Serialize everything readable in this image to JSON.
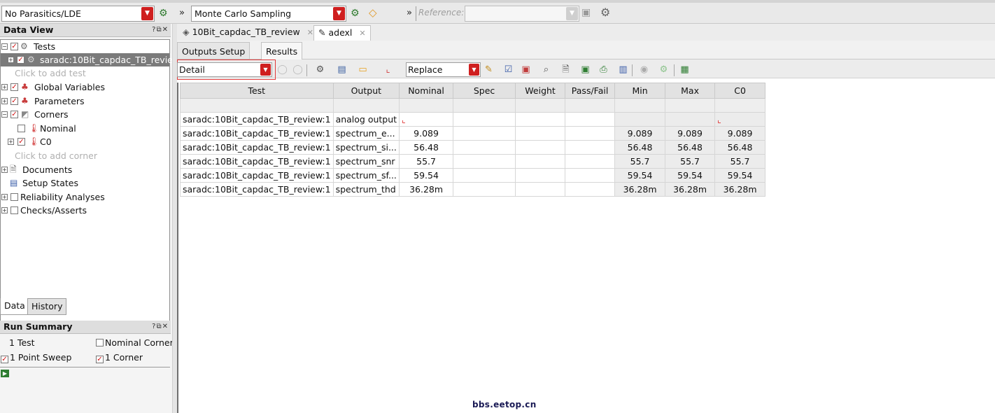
{
  "toolbar": {
    "parasitics_mode": "No Parasitics/LDE",
    "run_mode": "Monte Carlo Sampling",
    "reference_label": "Reference:",
    "reference_value": ""
  },
  "data_view": {
    "title": "Data View",
    "tree": [
      {
        "label": "Tests"
      },
      {
        "label": "saradc:10Bit_capdac_TB_revie.."
      },
      {
        "label": "Click to add test"
      },
      {
        "label": "Global Variables"
      },
      {
        "label": "Parameters"
      },
      {
        "label": "Corners"
      },
      {
        "label": "Nominal"
      },
      {
        "label": "C0"
      },
      {
        "label": "Click to add corner"
      },
      {
        "label": "Documents"
      },
      {
        "label": "Setup States"
      },
      {
        "label": "Reliability Analyses"
      },
      {
        "label": "Checks/Asserts"
      }
    ],
    "tabs": [
      "Data",
      "History"
    ]
  },
  "run_summary": {
    "title": "Run Summary",
    "tests": "1 Test",
    "nominal_corner": "Nominal Corner",
    "point_sweep": "1 Point Sweep",
    "corners": "1 Corner"
  },
  "doc_tabs": [
    {
      "label": "10Bit_capdac_TB_review"
    },
    {
      "label": "adexl"
    }
  ],
  "sub_tabs": [
    "Outputs Setup",
    "Results"
  ],
  "results_toolbar": {
    "view_mode": "Detail",
    "plot_mode": "Replace"
  },
  "results_table": {
    "columns": [
      "Test",
      "Output",
      "Nominal",
      "Spec",
      "Weight",
      "Pass/Fail",
      "Min",
      "Max",
      "C0"
    ],
    "rows": [
      {
        "test": "saradc:10Bit_capdac_TB_review:1",
        "output": "analog output",
        "nominal": "",
        "spec": "",
        "weight": "",
        "pass": "",
        "min": "",
        "max": "",
        "c0": ""
      },
      {
        "test": "saradc:10Bit_capdac_TB_review:1",
        "output": "spectrum_e...",
        "nominal": "9.089",
        "spec": "",
        "weight": "",
        "pass": "",
        "min": "9.089",
        "max": "9.089",
        "c0": "9.089"
      },
      {
        "test": "saradc:10Bit_capdac_TB_review:1",
        "output": "spectrum_si...",
        "nominal": "56.48",
        "spec": "",
        "weight": "",
        "pass": "",
        "min": "56.48",
        "max": "56.48",
        "c0": "56.48"
      },
      {
        "test": "saradc:10Bit_capdac_TB_review:1",
        "output": "spectrum_snr",
        "nominal": "55.7",
        "spec": "",
        "weight": "",
        "pass": "",
        "min": "55.7",
        "max": "55.7",
        "c0": "55.7"
      },
      {
        "test": "saradc:10Bit_capdac_TB_review:1",
        "output": "spectrum_sf...",
        "nominal": "59.54",
        "spec": "",
        "weight": "",
        "pass": "",
        "min": "59.54",
        "max": "59.54",
        "c0": "59.54"
      },
      {
        "test": "saradc:10Bit_capdac_TB_review:1",
        "output": "spectrum_thd",
        "nominal": "36.28m",
        "spec": "",
        "weight": "",
        "pass": "",
        "min": "36.28m",
        "max": "36.28m",
        "c0": "36.28m"
      }
    ]
  },
  "watermark": "bbs.eetop.cn",
  "colors": {
    "accent": "#cf1f1f",
    "selection": "#7b7b7b",
    "header": "#e2e2e2"
  }
}
